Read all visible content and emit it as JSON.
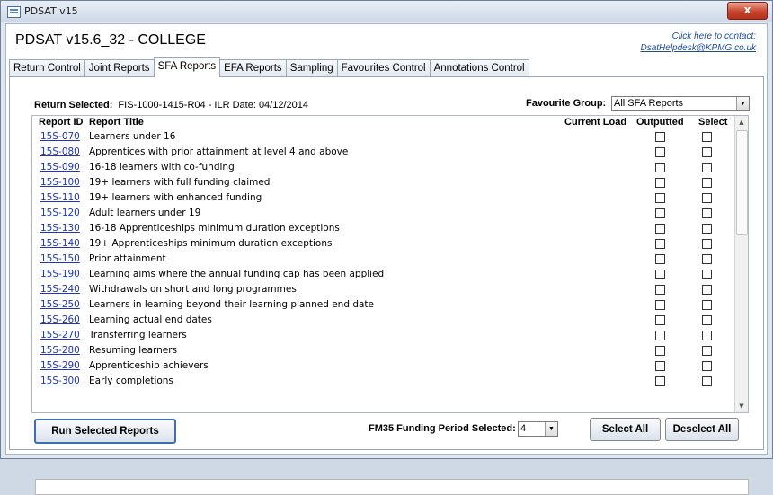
{
  "window": {
    "title": "PDSAT v15",
    "close_glyph": "x"
  },
  "app": {
    "heading": "PDSAT v15.6_32 - COLLEGE",
    "contact_line1": "Click here to contact:",
    "contact_line2": "DsatHelpdesk@KPMG.co.uk"
  },
  "tabs": [
    {
      "label": "Return Control"
    },
    {
      "label": "Joint Reports"
    },
    {
      "label": "SFA Reports",
      "active": true
    },
    {
      "label": "EFA Reports"
    },
    {
      "label": "Sampling"
    },
    {
      "label": "Favourites Control"
    },
    {
      "label": "Annotations Control"
    }
  ],
  "return_info": {
    "label": "Return Selected:",
    "value": "FIS-1000-1415-R04 - ILR Date: 04/12/2014"
  },
  "favourite": {
    "label": "Favourite Group:",
    "value": "All SFA Reports"
  },
  "grid": {
    "headers": {
      "id": "Report ID",
      "title": "Report Title",
      "current_load": "Current Load",
      "outputted": "Outputted",
      "select": "Select"
    },
    "rows": [
      {
        "id": "15S-070",
        "title": "Learners under 16"
      },
      {
        "id": "15S-080",
        "title": "Apprentices with prior attainment at level 4 and above"
      },
      {
        "id": "15S-090",
        "title": "16-18 learners with co-funding"
      },
      {
        "id": "15S-100",
        "title": "19+ learners with full funding claimed"
      },
      {
        "id": "15S-110",
        "title": "19+ learners with enhanced funding"
      },
      {
        "id": "15S-120",
        "title": "Adult learners under 19"
      },
      {
        "id": "15S-130",
        "title": "16-18 Apprenticeships minimum duration exceptions"
      },
      {
        "id": "15S-140",
        "title": "19+ Apprenticeships minimum duration exceptions"
      },
      {
        "id": "15S-150",
        "title": "Prior attainment"
      },
      {
        "id": "15S-190",
        "title": "Learning aims where the annual funding cap has been applied"
      },
      {
        "id": "15S-240",
        "title": "Withdrawals on short and long programmes"
      },
      {
        "id": "15S-250",
        "title": "Learners in learning beyond their learning planned end date"
      },
      {
        "id": "15S-260",
        "title": "Learning actual end dates"
      },
      {
        "id": "15S-270",
        "title": "Transferring learners"
      },
      {
        "id": "15S-280",
        "title": "Resuming learners"
      },
      {
        "id": "15S-290",
        "title": "Apprenticeship achievers"
      },
      {
        "id": "15S-300",
        "title": "Early completions"
      }
    ]
  },
  "buttons": {
    "run": "Run Selected Reports",
    "select_all": "Select All",
    "deselect_all": "Deselect All"
  },
  "fm35": {
    "label": "FM35 Funding Period Selected:",
    "value": "4"
  },
  "icons": {
    "dropdown": "chevron-down-icon",
    "scroll_up": "scroll-up-icon",
    "scroll_down": "scroll-down-icon",
    "app": "app-icon"
  }
}
